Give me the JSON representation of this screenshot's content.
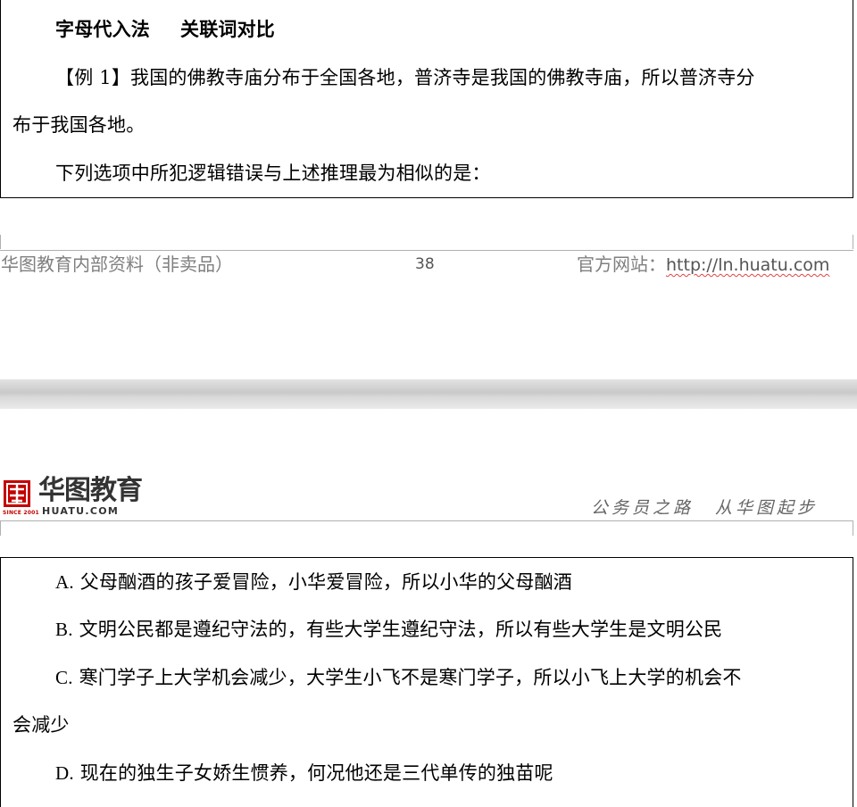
{
  "top_page": {
    "title_part1": "字母代入法",
    "title_part2": "关联词对比",
    "example_line1": "【例 1】我国的佛教寺庙分布于全国各地，普济寺是我国的佛教寺庙，所以普济寺分",
    "example_line2": "布于我国各地。",
    "question": "下列选项中所犯逻辑错误与上述推理最为相似的是："
  },
  "footer": {
    "left": "华图教育内部资料（非卖品）",
    "page_number": "38",
    "site_label": "官方网站：",
    "site_url": "http://ln.huatu.com"
  },
  "header": {
    "logo_text": "华图教育",
    "logo_domain": "HUATU.COM",
    "logo_since": "SINCE 2001",
    "slogan_part1": "公务员之路",
    "slogan_part2": "从华图起步",
    "brand_color": "#c40000"
  },
  "options": {
    "a_letter": "A.",
    "a_text": "父母酗酒的孩子爱冒险，小华爱冒险，所以小华的父母酗酒",
    "b_letter": "B.",
    "b_text": "文明公民都是遵纪守法的，有些大学生遵纪守法，所以有些大学生是文明公民",
    "c_letter": "C.",
    "c_text_line1": "寒门学子上大学机会减少，大学生小飞不是寒门学子，所以小飞上大学的机会不",
    "c_text_line2": "会减少",
    "d_letter": "D.",
    "d_text": "现在的独生子女娇生惯养，何况他还是三代单传的独苗呢"
  }
}
